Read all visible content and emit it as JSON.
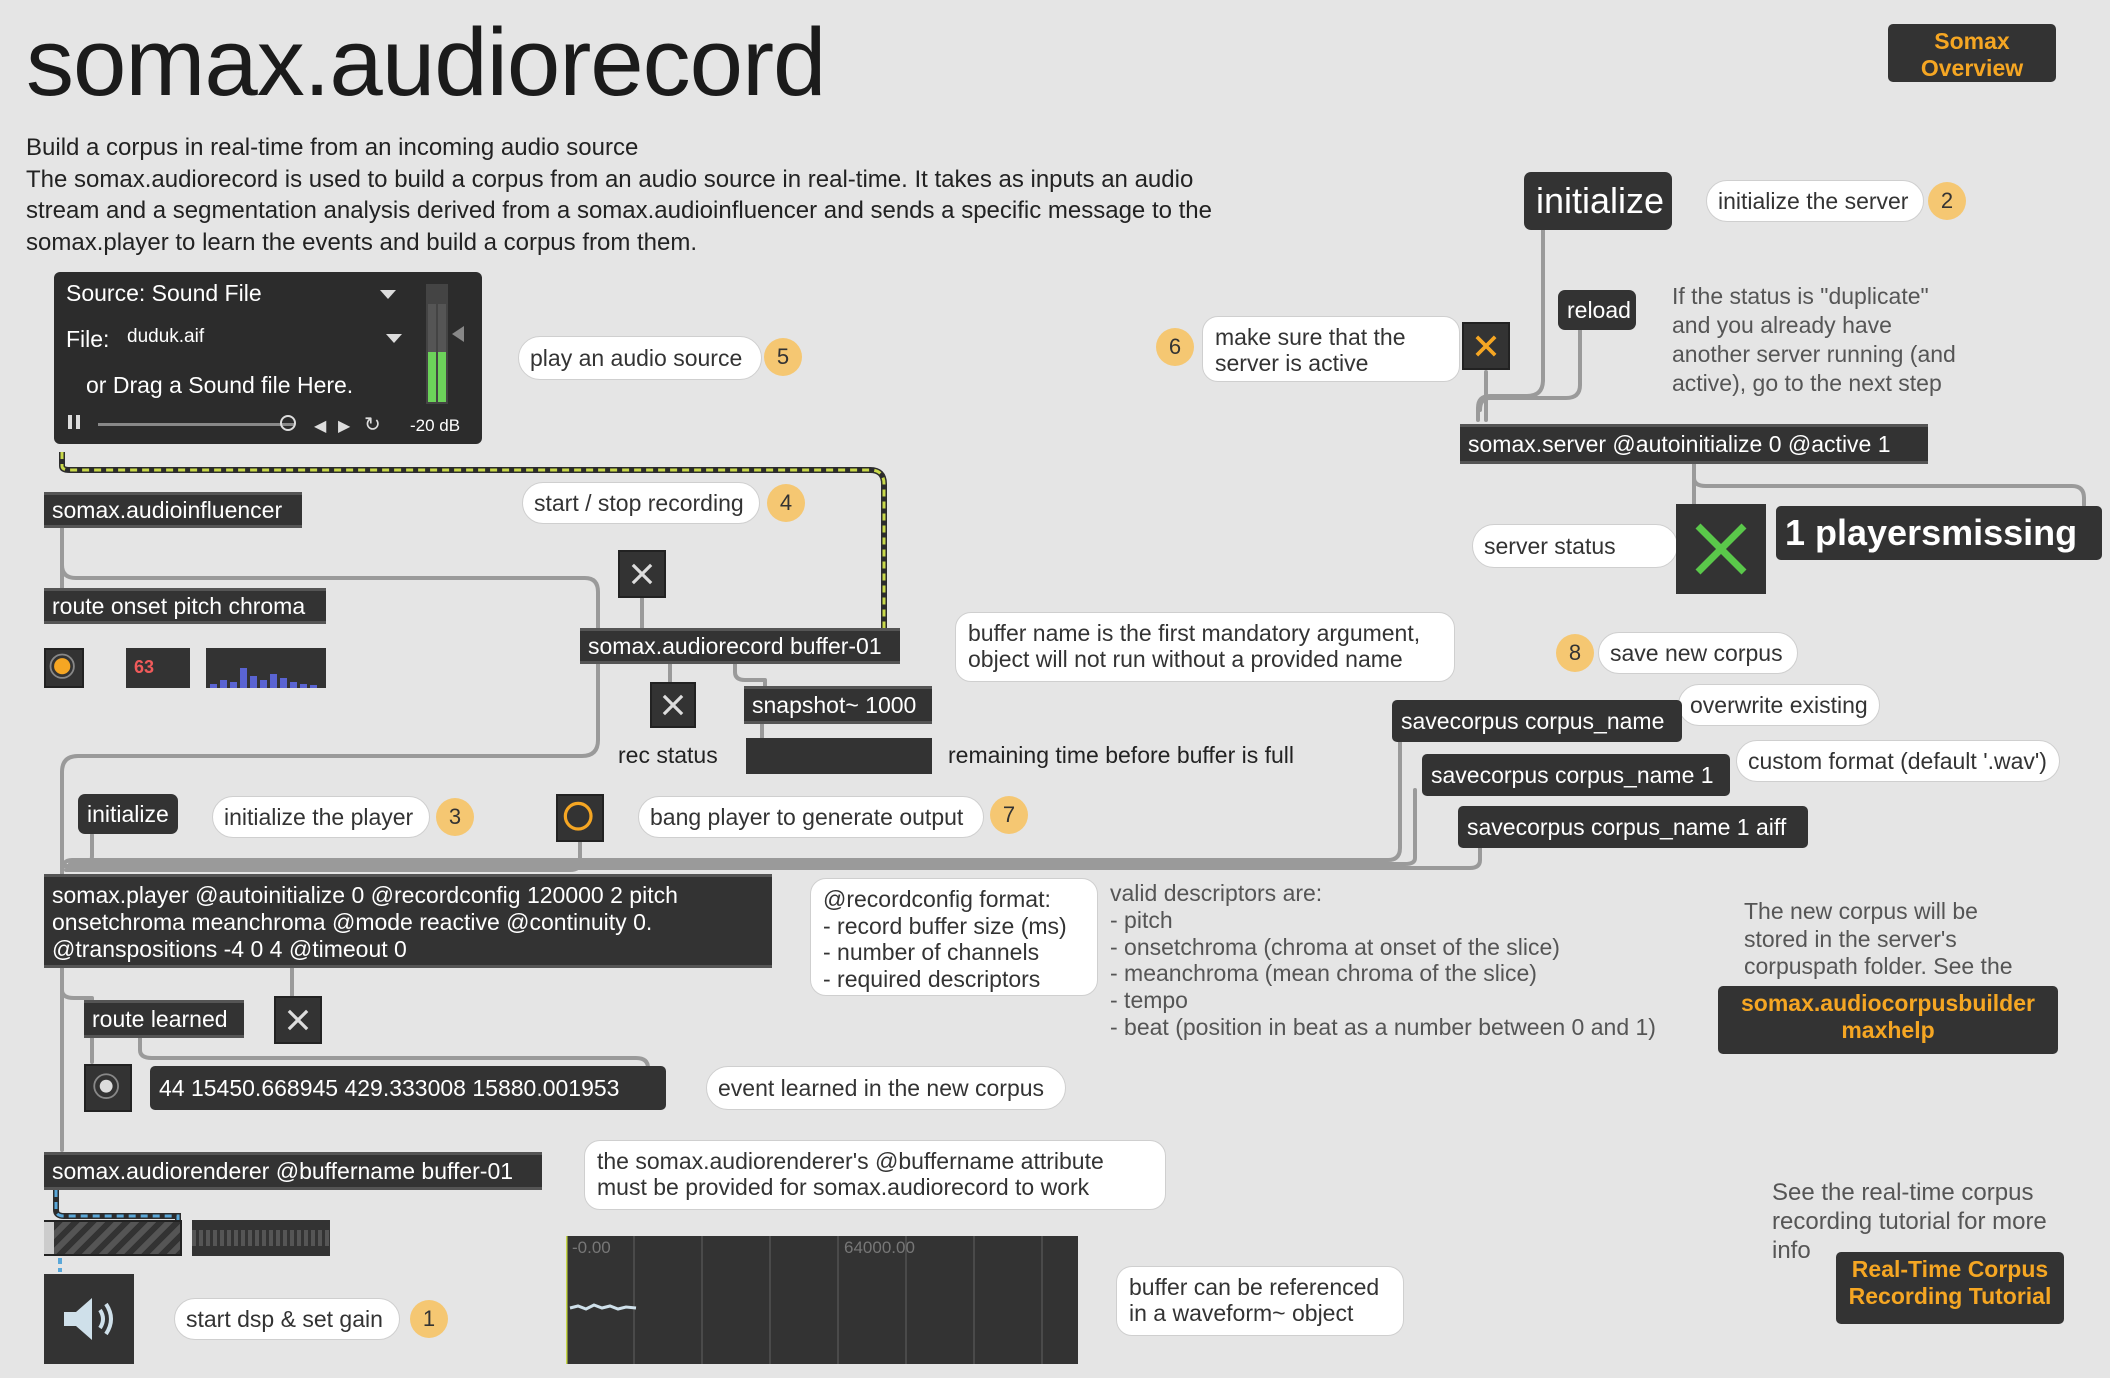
{
  "title": "somax.audiorecord",
  "description": {
    "heading": "Build a corpus in real-time from an incoming audio source",
    "line1": "The somax.audiorecord is used to build a corpus from an audio source in real-time. It takes as inputs an audio",
    "line2": "stream and a segmentation analysis derived from a somax.audioinfluencer and sends a specific message to the",
    "line3": "somax.player to learn the events and build a corpus from them."
  },
  "overview_button": "Somax\nOverview",
  "playlist": {
    "source_label": "Source: Sound File",
    "file_label": "File:",
    "file_value": "duduk.aif",
    "drag_text": "or Drag a Sound file Here.",
    "level": "-20 dB"
  },
  "objects": {
    "audioinfluencer": "somax.audioinfluencer",
    "route_onset": "route onset pitch chroma",
    "pitch_number": "63",
    "audiorecord": "somax.audiorecord buffer-01",
    "snapshot": "snapshot~ 1000",
    "player": "somax.player @autoinitialize 0 @recordconfig 120000 2 pitch\nonsetchroma meanchroma @mode reactive @continuity 0.\n@transpositions -4 0 4 @timeout 0",
    "route_learned": "route learned",
    "learned_message": "44 15450.668945 429.333008 15880.001953",
    "audiorenderer": "somax.audiorenderer @buffername buffer-01",
    "server": "somax.server @autoinitialize 0 @active 1",
    "savecorpus1": "savecorpus corpus_name",
    "savecorpus2": "savecorpus corpus_name 1",
    "savecorpus3": "savecorpus corpus_name 1 aiff",
    "initialize_server": "initialize",
    "reload": "reload",
    "initialize_player": "initialize",
    "status_message": "1 playersmissing"
  },
  "bubbles": {
    "play_audio": "play an audio source",
    "start_stop": "start / stop recording",
    "buffer_name": "buffer name is the first mandatory argument,\nobject will not run without a provided name",
    "initialize_player": "initialize the player",
    "bang_player": "bang player to generate output",
    "recordconfig": "@recordconfig format:\n- record buffer size (ms)\n- number of channels\n- required descriptors",
    "event_learned": "event learned in the new corpus",
    "audiorenderer_note": "the somax.audiorenderer's @buffername attribute\nmust be provided for somax.audiorecord to work",
    "buffer_waveform": "buffer can be referenced\nin a waveform~ object",
    "start_dsp": "start dsp & set gain",
    "initialize_server": "initialize the server",
    "server_active": "make sure that the\nserver is active",
    "server_status": "server status",
    "save_new_corpus": "save new corpus",
    "overwrite": "overwrite existing",
    "custom_format": "custom format (default '.wav')"
  },
  "steps": [
    "1",
    "2",
    "3",
    "4",
    "5",
    "6",
    "7",
    "8"
  ],
  "comments": {
    "rec_status": "rec status",
    "remaining_time": "remaining time before buffer is full",
    "duplicate_note": "If the status is \"duplicate\"\nand you already have\nanother server running (and\nactive), go to the next step",
    "valid_descriptors": "valid descriptors are:\n- pitch\n- onsetchroma (chroma at onset of the slice)\n- meanchroma (mean chroma of the slice)\n- tempo\n- beat (position in beat as a number between 0 and 1)",
    "new_corpus_note": "The new corpus will be\nstored in the server's\ncorpuspath folder. See the",
    "tutorial_note": "See the real-time corpus\nrecording tutorial for more\ninfo"
  },
  "links": {
    "corpusbuilder": "somax.audiocorpusbuilder\nmaxhelp",
    "tutorial": "Real-Time Corpus\nRecording Tutorial"
  },
  "waveform": {
    "left_label": "-0.00",
    "mid_label": "64000.00"
  },
  "colors": {
    "background": "#e5e5e5",
    "object": "#333333",
    "accent_orange": "#f5a623",
    "step_badge": "#f5c772",
    "status_green": "#5ac84a",
    "wire_dash": "#c8d84a",
    "audio_wire": "#5aa7d8"
  },
  "icons": {
    "toggle": "x-icon",
    "bang": "circle-icon",
    "speaker": "speaker-icon",
    "play": "play-icon",
    "pause": "pause-icon"
  }
}
